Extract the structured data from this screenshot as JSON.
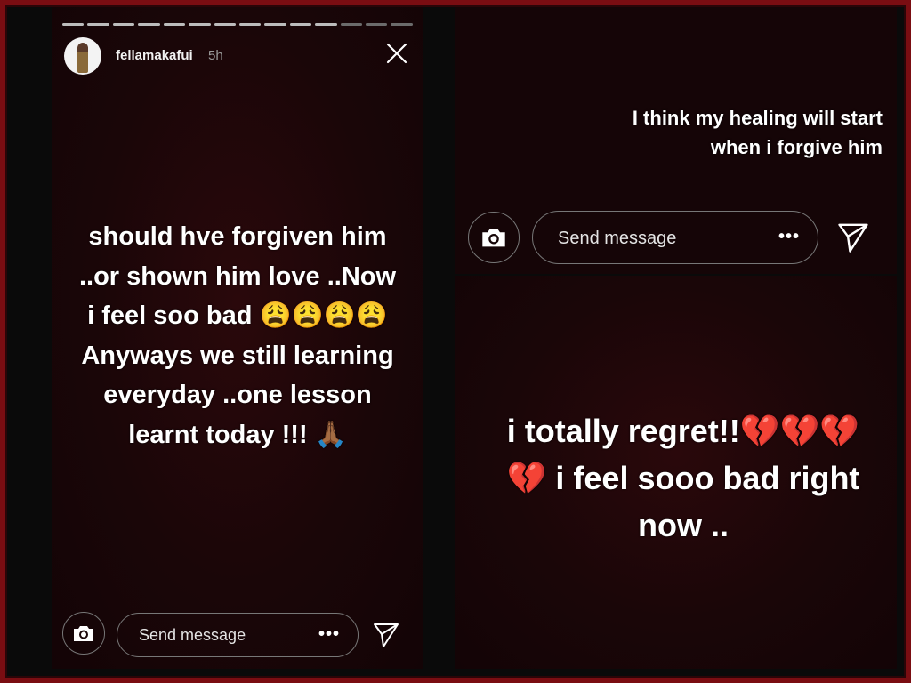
{
  "story_left": {
    "username": "fellamakafui",
    "time": "5h",
    "progress_segments_total": 14,
    "progress_segments_viewed": 11,
    "text": "should hve forgiven him ..or shown him love ..Now i feel soo bad 😩😩😩😩 Anyways we still learning everyday ..one lesson learnt today !!! 🙏🏾",
    "reply": {
      "placeholder": "Send message",
      "more": "•••"
    }
  },
  "story_right_top": {
    "text": "I think my healing will start when i forgive him",
    "reply": {
      "placeholder": "Send message",
      "more": "•••"
    }
  },
  "story_right_bottom": {
    "text": "i totally regret!!💔💔💔💔 i feel sooo bad right now .."
  },
  "icons": {
    "camera": "camera-icon",
    "send": "send-icon",
    "close": "close-icon",
    "avatar": "avatar"
  },
  "colors": {
    "border": "#7a0d12",
    "story_bg": "#1a0608",
    "text": "#ffffff"
  }
}
